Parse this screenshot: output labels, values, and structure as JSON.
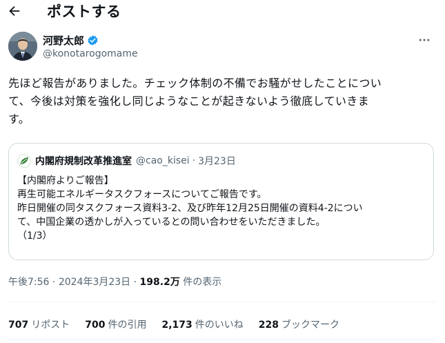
{
  "header": {
    "title": "ポストする"
  },
  "author": {
    "name": "河野太郎",
    "handle": "@konotarogomame"
  },
  "post": {
    "text_lines": [
      "先ほど報告がありました。チェック体制の不備でお騒がせしたことについ",
      "て、今後は対策を強化し同じようなことが起きないよう徹底していきま",
      "す。"
    ]
  },
  "quote": {
    "name": "内閣府規制改革推進室",
    "handle": "@cao_kisei",
    "separator": "·",
    "date": "3月23日",
    "lines": [
      "【内閣府よりご報告】",
      "再生可能エネルギータスクフォースについてご報告です。",
      "昨日開催の同タスクフォース資料3-2、及び昨年12月25日開催の資料4-2につい",
      "て、中国企業の透かしが入っているとの問い合わせをいただきました。",
      "（1/3）"
    ]
  },
  "meta": {
    "time": "午後7:56",
    "separator": "·",
    "date": "2024年3月23日",
    "views_count": "198.2万",
    "views_label": "件の表示"
  },
  "stats": [
    {
      "count": "707",
      "label": "リポスト"
    },
    {
      "count": "700",
      "label": "件の引用"
    },
    {
      "count": "2,173",
      "label": "件のいいね"
    },
    {
      "count": "228",
      "label": "ブックマーク"
    }
  ],
  "colors": {
    "verified": "#1d9bf0",
    "secondary_text": "#536471",
    "border": "#cfd9de",
    "quote_logo": "#2e7d32"
  },
  "icons": {
    "back": "arrow-left-icon",
    "verified": "verified-badge-icon",
    "more": "more-icon"
  }
}
